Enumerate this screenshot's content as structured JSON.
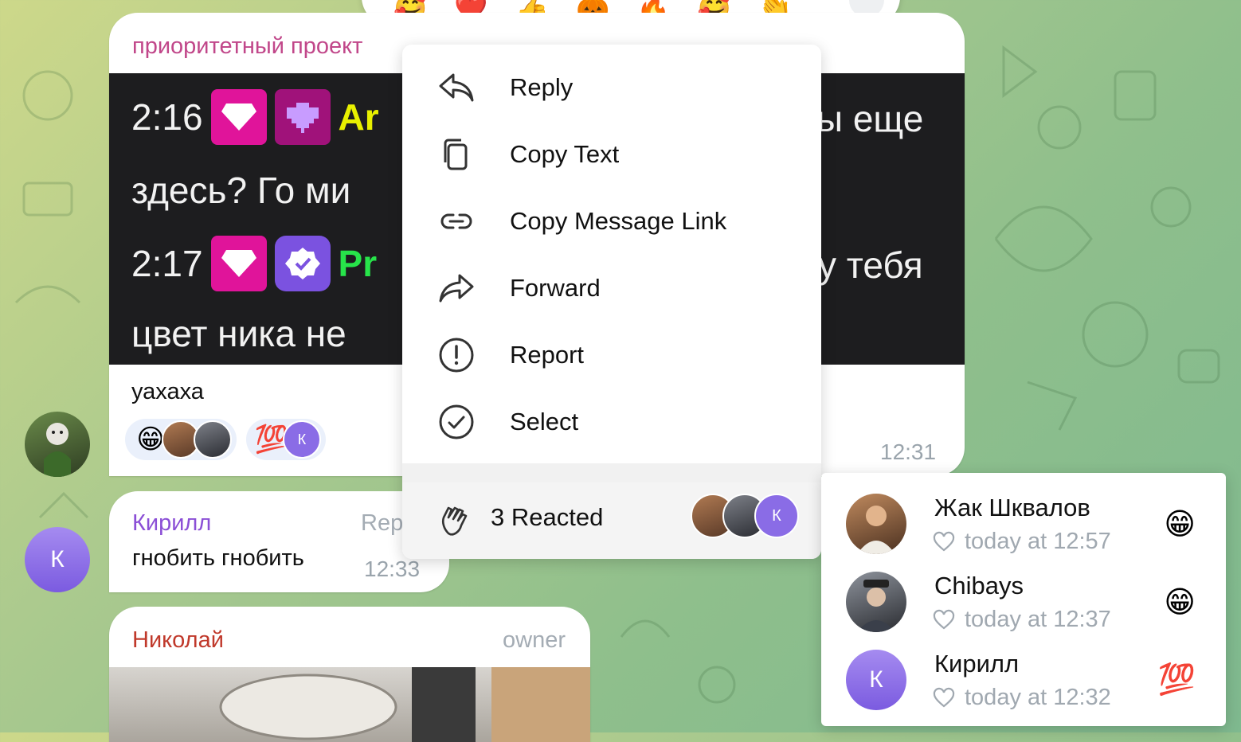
{
  "emoji_bar": {
    "emojis": [
      "🥰",
      "❤️",
      "👍",
      "🎃",
      "🔥",
      "🥰",
      "👏"
    ]
  },
  "messages": [
    {
      "sender": "приоритетный проект",
      "image_text": {
        "line1_time": "2:16",
        "line1_nick": "Ar",
        "line1_tail": "ы еще",
        "line2": "здесь? Го ми",
        "line3_time": "2:17",
        "line3_nick": "Pr",
        "line3_tail": "у тебя",
        "line4": "цвет ника не"
      },
      "caption": "уахаха",
      "reactions": [
        {
          "emoji": "😁",
          "users": [
            "Жак Шквалов",
            "Chibays"
          ]
        },
        {
          "emoji": "💯",
          "users": [
            "К"
          ]
        }
      ],
      "time": "12:31"
    },
    {
      "sender": "Кирилл",
      "avatar_letter": "К",
      "reply_label": "Rep",
      "text": "гнобить гнобить",
      "time": "12:33"
    },
    {
      "sender": "Николай",
      "role": "owner"
    }
  ],
  "context_menu": {
    "items": [
      {
        "label": "Reply",
        "icon": "reply-icon"
      },
      {
        "label": "Copy Text",
        "icon": "copy-icon"
      },
      {
        "label": "Copy Message Link",
        "icon": "link-icon"
      },
      {
        "label": "Forward",
        "icon": "forward-icon"
      },
      {
        "label": "Report",
        "icon": "report-icon"
      },
      {
        "label": "Select",
        "icon": "select-icon"
      }
    ],
    "reacted_label": "3 Reacted",
    "reacted_avatar_letter": "К"
  },
  "reactors": [
    {
      "name": "Жак Шквалов",
      "when": "today at 12:57",
      "emoji": "😁"
    },
    {
      "name": "Chibays",
      "when": "today at 12:37",
      "emoji": "😁"
    },
    {
      "name": "Кирилл",
      "when": "today at 12:32",
      "emoji": "💯",
      "avatar_letter": "К"
    }
  ],
  "colors": {
    "accent_pink": "#c1478a",
    "sender_purple": "#8b4fd6",
    "sender_red": "#c0392b",
    "avatar_purple": "#8a6ce6"
  }
}
